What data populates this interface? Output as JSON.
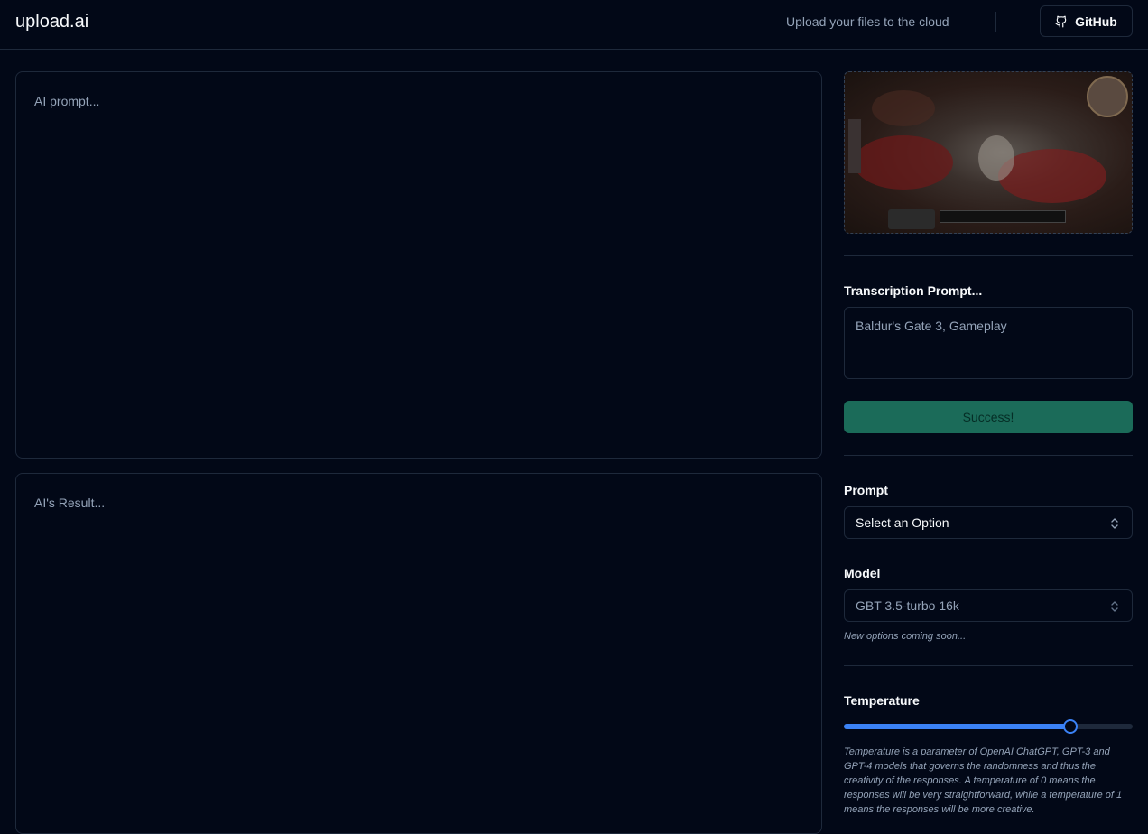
{
  "header": {
    "logo": "upload.ai",
    "tagline": "Upload your files to the cloud",
    "github_label": "GitHub"
  },
  "main": {
    "prompt_placeholder": "AI prompt...",
    "result_placeholder": "AI's Result..."
  },
  "sidebar": {
    "transcription_label": "Transcription Prompt...",
    "transcription_value": "Baldur's Gate 3, Gameplay",
    "status_button_label": "Success!",
    "prompt_label": "Prompt",
    "prompt_select_value": "Select an Option",
    "model_label": "Model",
    "model_select_value": "GBT 3.5-turbo 16k",
    "model_hint": "New options coming soon...",
    "temperature_label": "Temperature",
    "temperature_value_fraction": 0.785,
    "temperature_description": "Temperature is a parameter of OpenAI ChatGPT, GPT-3 and GPT-4 models that governs the randomness and thus the creativity of the responses. A temperature of 0 means the responses will be very straightforward, while a temperature of 1 means the responses will be more creative."
  },
  "colors": {
    "background": "#020817",
    "border": "#1e293b",
    "success": "#1b6b59",
    "accent": "#3b82f6"
  },
  "icons": {
    "github": "github-icon",
    "select_chevron": "chevron-up-down-icon"
  }
}
